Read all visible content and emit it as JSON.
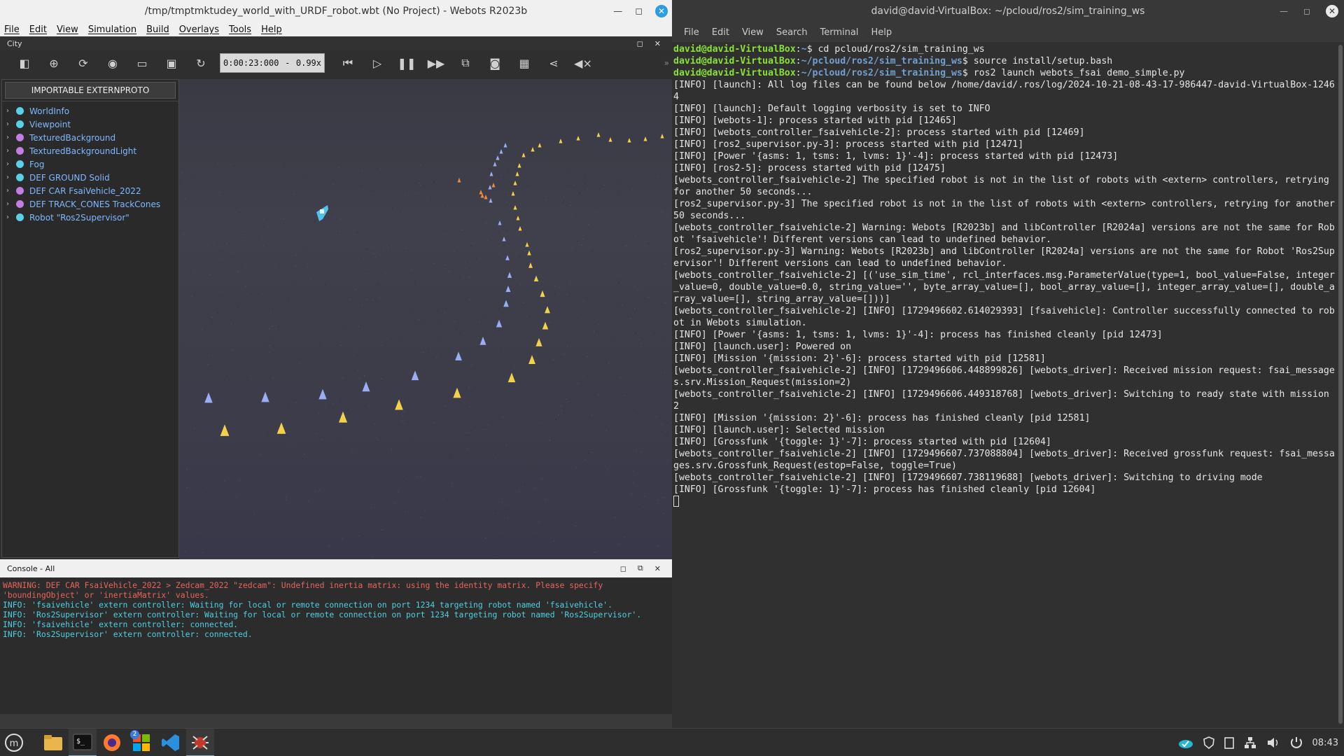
{
  "webots": {
    "title": "/tmp/tmptmktudey_world_with_URDF_robot.wbt (No Project) - Webots R2023b",
    "menu": [
      "File",
      "Edit",
      "View",
      "Simulation",
      "Build",
      "Overlays",
      "Tools",
      "Help"
    ],
    "pane_title": "City",
    "time": "0:00:23:000",
    "speed": "0.99x",
    "importable_btn": "IMPORTABLE EXTERNPROTO",
    "tree": [
      {
        "label": "WorldInfo",
        "color": "#5ad0e6"
      },
      {
        "label": "Viewpoint",
        "color": "#5ad0e6"
      },
      {
        "label": "TexturedBackground",
        "color": "#c47de0"
      },
      {
        "label": "TexturedBackgroundLight",
        "color": "#c47de0"
      },
      {
        "label": "Fog",
        "color": "#5ad0e6"
      },
      {
        "label": "DEF GROUND Solid",
        "color": "#5ad0e6"
      },
      {
        "label": "DEF CAR FsaiVehicle_2022",
        "color": "#c47de0"
      },
      {
        "label": "DEF TRACK_CONES TrackCones",
        "color": "#c47de0"
      },
      {
        "label": "Robot \"Ros2Supervisor\"",
        "color": "#5ad0e6"
      }
    ],
    "console_title": "Console - All",
    "console_lines": [
      {
        "type": "warn",
        "text": "WARNING: DEF CAR FsaiVehicle_2022 > Zedcam_2022 \"zedcam\": Undefined inertia matrix: using the identity matrix. Please specify 'boundingObject' or 'inertiaMatrix' values."
      },
      {
        "type": "info",
        "text": "INFO: 'fsaivehicle' extern controller: Waiting for local or remote connection on port 1234 targeting robot named 'fsaivehicle'."
      },
      {
        "type": "info",
        "text": "INFO: 'Ros2Supervisor' extern controller: Waiting for local or remote connection on port 1234 targeting robot named 'Ros2Supervisor'."
      },
      {
        "type": "info",
        "text": "INFO: 'fsaivehicle' extern controller: connected."
      },
      {
        "type": "info",
        "text": "INFO: 'Ros2Supervisor' extern controller: connected."
      }
    ]
  },
  "terminal": {
    "title": "david@david-VirtualBox: ~/pcloud/ros2/sim_training_ws",
    "menu": [
      "File",
      "Edit",
      "View",
      "Search",
      "Terminal",
      "Help"
    ],
    "prompt_lines": [
      {
        "user": "david@david-VirtualBox",
        "path": "~",
        "cmd": "cd pcloud/ros2/sim_training_ws"
      },
      {
        "user": "david@david-VirtualBox",
        "path": "~/pcloud/ros2/sim_training_ws",
        "cmd": "source install/setup.bash"
      },
      {
        "user": "david@david-VirtualBox",
        "path": "~/pcloud/ros2/sim_training_ws",
        "cmd": "ros2 launch webots_fsai demo_simple.py"
      }
    ],
    "output_lines": [
      "[INFO] [launch]: All log files can be found below /home/david/.ros/log/2024-10-21-08-43-17-986447-david-VirtualBox-12464",
      "[INFO] [launch]: Default logging verbosity is set to INFO",
      "[INFO] [webots-1]: process started with pid [12465]",
      "[INFO] [webots_controller_fsaivehicle-2]: process started with pid [12469]",
      "[INFO] [ros2_supervisor.py-3]: process started with pid [12471]",
      "[INFO] [Power '{asms: 1, tsms: 1, lvms: 1}'-4]: process started with pid [12473]",
      "[INFO] [ros2-5]: process started with pid [12475]",
      "[webots_controller_fsaivehicle-2] The specified robot is not in the list of robots with <extern> controllers, retrying for another 50 seconds...",
      "[ros2_supervisor.py-3] The specified robot is not in the list of robots with <extern> controllers, retrying for another 50 seconds...",
      "[webots_controller_fsaivehicle-2] Warning: Webots [R2023b] and libController [R2024a] versions are not the same for Robot 'fsaivehicle'! Different versions can lead to undefined behavior.",
      "[ros2_supervisor.py-3] Warning: Webots [R2023b] and libController [R2024a] versions are not the same for Robot 'Ros2Supervisor'! Different versions can lead to undefined behavior.",
      "[webots_controller_fsaivehicle-2] [('use_sim_time', rcl_interfaces.msg.ParameterValue(type=1, bool_value=False, integer_value=0, double_value=0.0, string_value='', byte_array_value=[], bool_array_value=[], integer_array_value=[], double_array_value=[], string_array_value=[]))]",
      "[webots_controller_fsaivehicle-2] [INFO] [1729496602.614029393] [fsaivehicle]: Controller successfully connected to robot in Webots simulation.",
      "[INFO] [Power '{asms: 1, tsms: 1, lvms: 1}'-4]: process has finished cleanly [pid 12473]",
      "[INFO] [launch.user]: Powered on",
      "[INFO] [Mission '{mission: 2}'-6]: process started with pid [12581]",
      "[webots_controller_fsaivehicle-2] [INFO] [1729496606.448899826] [webots_driver]: Received mission request: fsai_messages.srv.Mission_Request(mission=2)",
      "[webots_controller_fsaivehicle-2] [INFO] [1729496606.449318768] [webots_driver]: Switching to ready state with mission 2",
      "[INFO] [Mission '{mission: 2}'-6]: process has finished cleanly [pid 12581]",
      "[INFO] [launch.user]: Selected mission",
      "[INFO] [Grossfunk '{toggle: 1}'-7]: process started with pid [12604]",
      "[webots_controller_fsaivehicle-2] [INFO] [1729496607.737088804] [webots_driver]: Received grossfunk request: fsai_messages.srv.Grossfunk_Request(estop=False, toggle=True)",
      "[webots_controller_fsaivehicle-2] [INFO] [1729496607.738119688] [webots_driver]: Switching to driving mode",
      "[INFO] [Grossfunk '{toggle: 1}'-7]: process has finished cleanly [pid 12604]"
    ]
  },
  "taskbar": {
    "badge": "2",
    "clock": "08:43"
  }
}
